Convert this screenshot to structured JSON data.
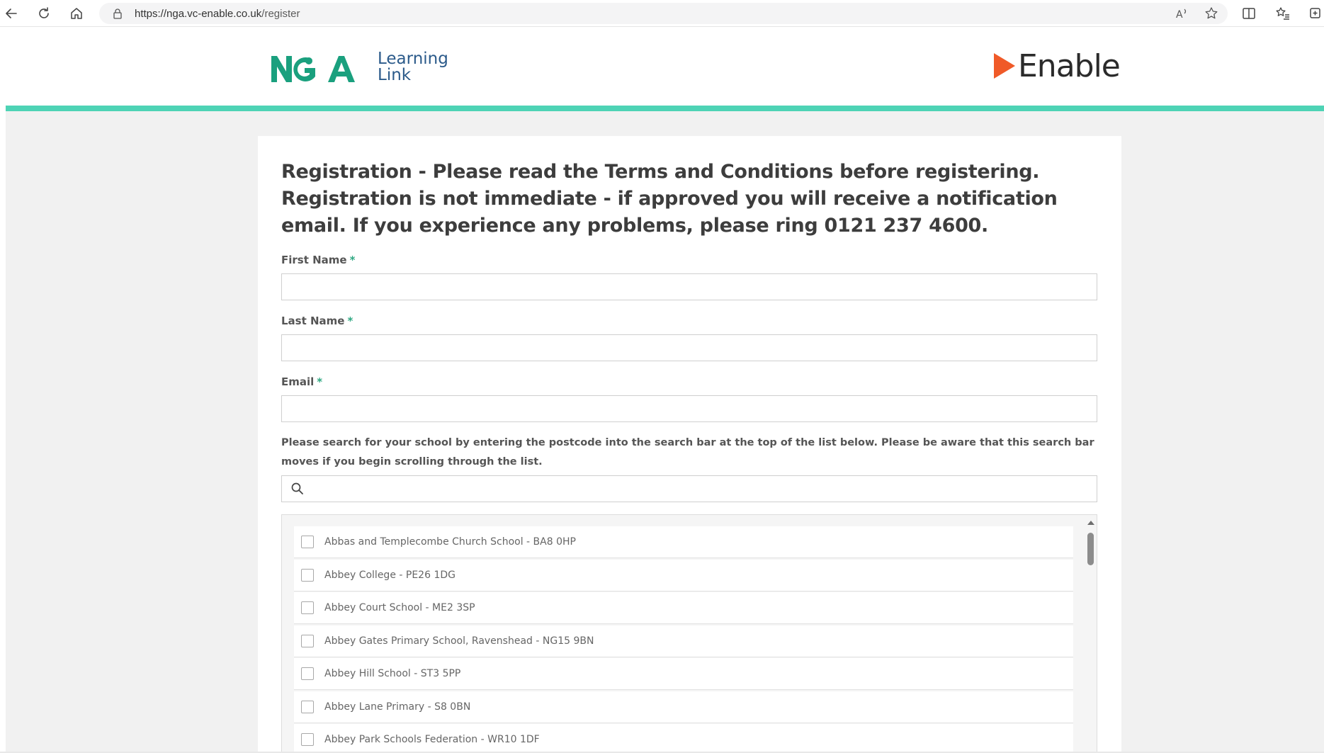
{
  "browser": {
    "url_prefix": "https://nga.vc-enable.co.uk",
    "url_path": "/register"
  },
  "header": {
    "left_logo_line1": "Learning",
    "left_logo_line2": "Link",
    "right_logo_word": "Enable"
  },
  "form": {
    "title": "Registration - Please read the Terms and Conditions before registering. Registration is not immediate - if approved you will receive a notification email. If you experience any problems, please ring 0121 237 4600.",
    "fields": {
      "first_name": {
        "label": "First Name",
        "required_mark": "*",
        "value": ""
      },
      "last_name": {
        "label": "Last Name",
        "required_mark": "*",
        "value": ""
      },
      "email": {
        "label": "Email",
        "required_mark": "*",
        "value": ""
      }
    },
    "school_help": "Please search for your school by entering the postcode into the search bar at the top of the list below. Please be aware that this search bar moves if you begin scrolling through the list.",
    "school_search_value": "",
    "schools": [
      "Abbas and Templecombe Church School - BA8 0HP",
      "Abbey College - PE26 1DG",
      "Abbey Court School - ME2 3SP",
      "Abbey Gates Primary School, Ravenshead - NG15 9BN",
      "Abbey Hill School - ST3 5PP",
      "Abbey Lane Primary - S8 0BN",
      "Abbey Park Schools Federation - WR10 1DF"
    ]
  },
  "colors": {
    "accent_teal": "#4ed3b5",
    "nga_green": "#1aa07e",
    "enable_orange": "#f05a28",
    "required_green": "#2fa882"
  },
  "icons": {
    "back": "arrow-left",
    "refresh": "refresh",
    "home": "home",
    "lock": "lock",
    "read_aloud": "read-aloud",
    "favorite": "star",
    "split_screen": "split-screen",
    "favorites_list": "favorites",
    "collections": "collections",
    "search": "magnifier"
  }
}
